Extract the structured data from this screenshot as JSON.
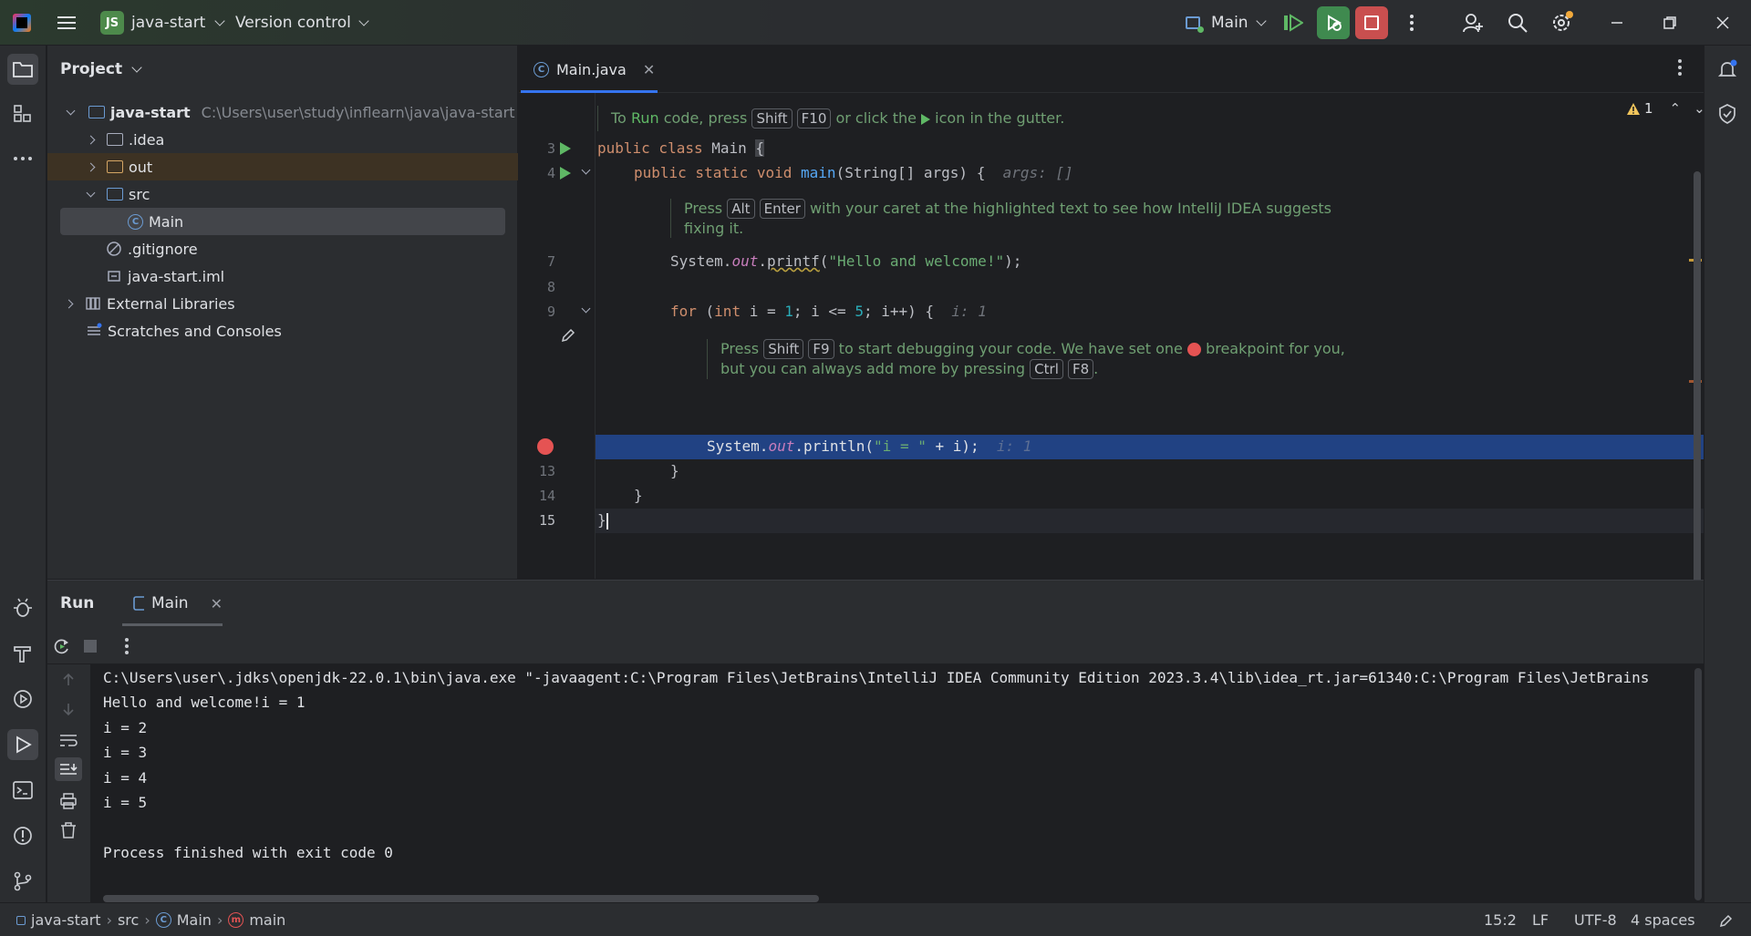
{
  "titlebar": {
    "project_badge": "JS",
    "project_name": "java-start",
    "vcs_label": "Version control",
    "run_config": "Main"
  },
  "project_panel": {
    "title": "Project",
    "tree": [
      {
        "label": "java-start",
        "hint": "C:\\Users\\user\\study\\inflearn\\java\\java-start"
      },
      {
        "label": ".idea"
      },
      {
        "label": "out"
      },
      {
        "label": "src"
      },
      {
        "label": "Main"
      },
      {
        "label": ".gitignore"
      },
      {
        "label": "java-start.iml"
      },
      {
        "label": "External Libraries"
      },
      {
        "label": "Scratches and Consoles"
      }
    ]
  },
  "editor": {
    "tab_label": "Main.java",
    "warning_count": "1",
    "tip_run": {
      "pre": "To ",
      "run_word": "Run",
      "mid": " code, press ",
      "k1": "Shift",
      "k2": "F10",
      "post": " or click the ",
      "post2": " icon in the gutter."
    },
    "line_numbers": [
      "3",
      "4",
      "7",
      "8",
      "9",
      "13",
      "14",
      "15"
    ],
    "tip_alt_enter": {
      "pre": "Press ",
      "k1": "Alt",
      "k2": "Enter",
      "post": " with your caret at the highlighted text to see how IntelliJ IDEA suggests",
      "line2": "fixing it."
    },
    "tip_debug": {
      "pre": "Press ",
      "k1": "Shift",
      "k2": "F9",
      "mid": " to start debugging your code. We have set one ",
      "post": " breakpoint for you,",
      "line2_pre": "but you can always add more by pressing ",
      "k3": "Ctrl",
      "k4": "F8",
      "line2_post": "."
    },
    "code": {
      "l3_kw": "public class ",
      "l3_name": "Main ",
      "l3_brace": "{",
      "l4_kw": "public static void ",
      "l4_fn": "main",
      "l4_rest": "(String[] args) {",
      "l4_hint": "args: []",
      "l7_a": "System.",
      "l7_out": "out",
      "l7_b": ".",
      "l7_fn": "printf",
      "l7_c": "(",
      "l7_str": "\"Hello and welcome!\"",
      "l7_d": ");",
      "l9_kw": "for",
      "l9_a": " (",
      "l9_int": "int",
      "l9_b": " i = ",
      "l9_n1": "1",
      "l9_c": "; i <= ",
      "l9_n5": "5",
      "l9_d": "; i++) {",
      "l9_hint": "i: 1",
      "l11_a": "System.",
      "l11_out": "out",
      "l11_b": ".println(",
      "l11_str": "\"i = \"",
      "l11_c": " + i);",
      "l11_hint": "i: 1",
      "l13": "}",
      "l14": "}",
      "l15": "}"
    }
  },
  "run_panel": {
    "title": "Run",
    "tab_label": "Main",
    "console": [
      "C:\\Users\\user\\.jdks\\openjdk-22.0.1\\bin\\java.exe \"-javaagent:C:\\Program Files\\JetBrains\\IntelliJ IDEA Community Edition 2023.3.4\\lib\\idea_rt.jar=61340:C:\\Program Files\\JetBrains",
      "Hello and welcome!i = 1",
      "i = 2",
      "i = 3",
      "i = 4",
      "i = 5",
      "",
      "Process finished with exit code 0"
    ]
  },
  "statusbar": {
    "breadcrumbs": [
      "java-start",
      "src",
      "Main",
      "main"
    ],
    "position": "15:2",
    "line_ending": "LF",
    "encoding": "UTF-8",
    "indent": "4 spaces"
  },
  "colors": {
    "accent": "#3574f0",
    "run_green": "#5fb865",
    "stop_red": "#c94f4f",
    "breakpoint_line": "#214283"
  }
}
